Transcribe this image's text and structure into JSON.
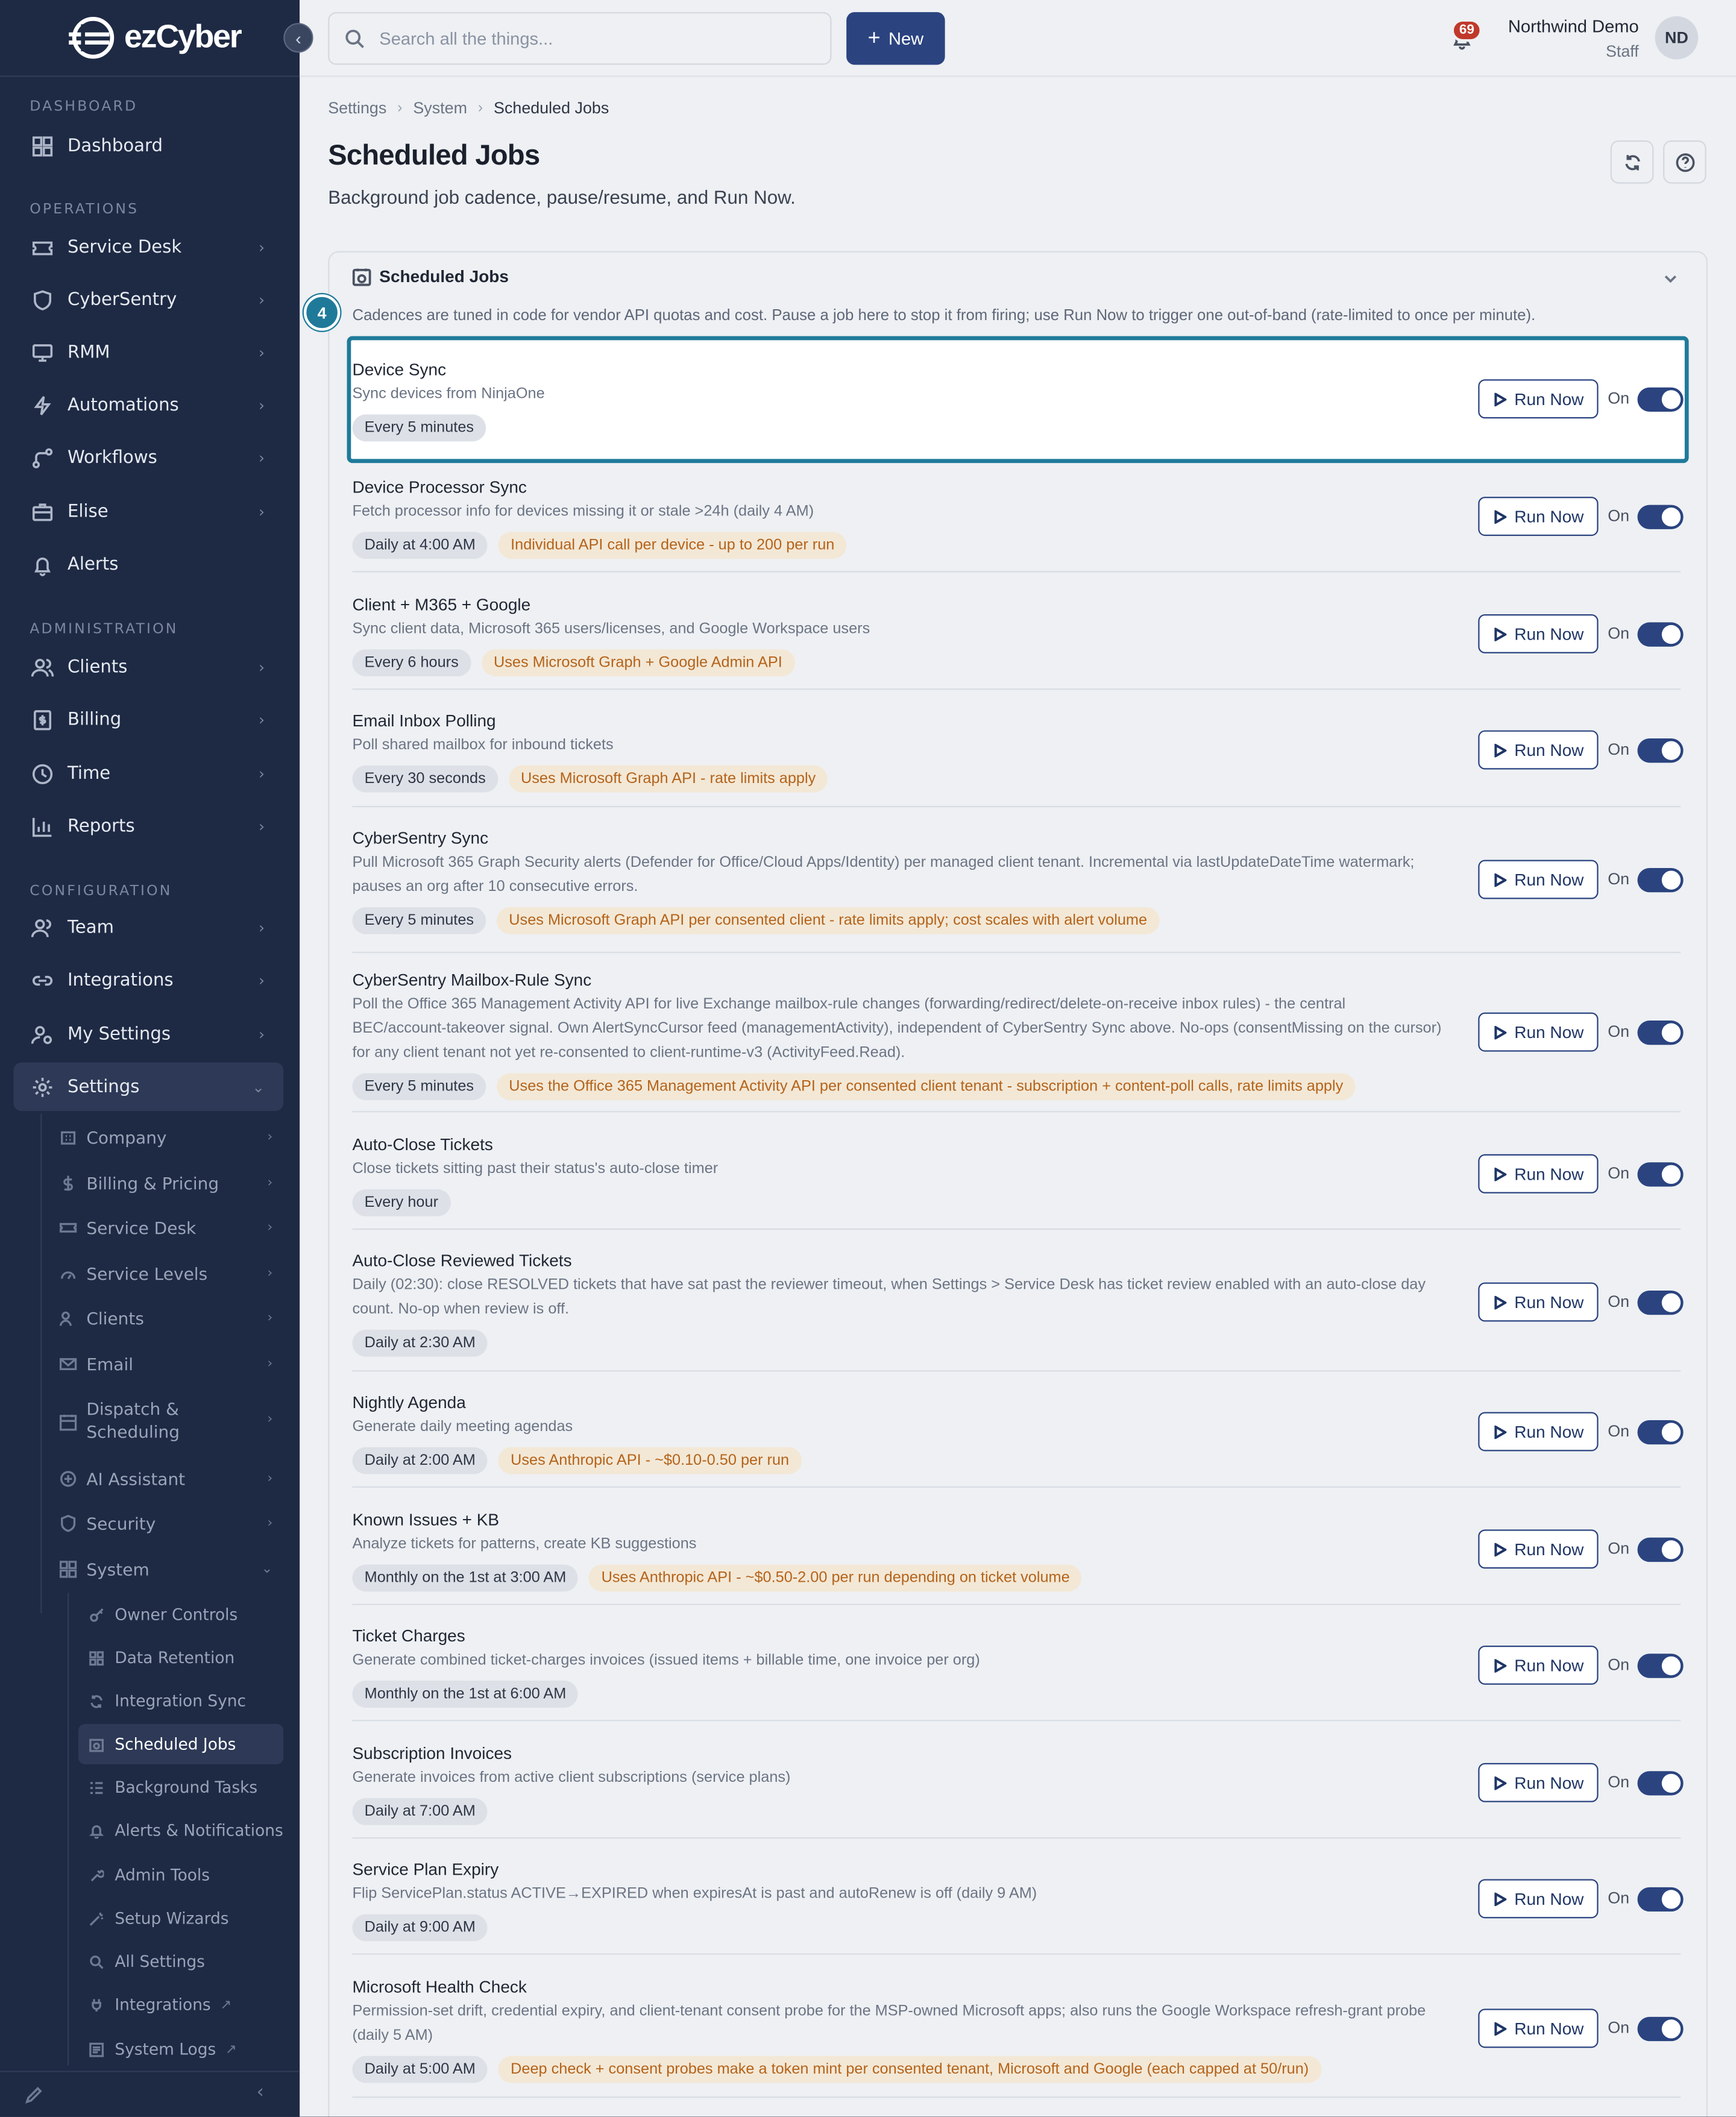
{
  "app": {
    "name": "ezCyber"
  },
  "sidebar": {
    "sections": {
      "dashboard": "DASHBOARD",
      "operations": "OPERATIONS",
      "administration": "ADMINISTRATION",
      "configuration": "CONFIGURATION"
    },
    "items": {
      "dashboard": "Dashboard",
      "service_desk": "Service Desk",
      "cybersentry": "CyberSentry",
      "rmm": "RMM",
      "automations": "Automations",
      "workflows": "Workflows",
      "elise": "Elise",
      "alerts": "Alerts",
      "clients": "Clients",
      "billing": "Billing",
      "time": "Time",
      "reports": "Reports",
      "team": "Team",
      "integrations": "Integrations",
      "my_settings": "My Settings",
      "settings": "Settings"
    },
    "settings_sub": {
      "company": "Company",
      "billing_pricing": "Billing & Pricing",
      "service_desk": "Service Desk",
      "service_levels": "Service Levels",
      "clients": "Clients",
      "email": "Email",
      "dispatch_1": "Dispatch &",
      "dispatch_2": "Scheduling",
      "ai_assistant": "AI Assistant",
      "security": "Security",
      "system": "System"
    },
    "system_sub": {
      "owner_controls": "Owner Controls",
      "data_retention": "Data Retention",
      "integration_sync": "Integration Sync",
      "scheduled_jobs": "Scheduled Jobs",
      "background_tasks": "Background Tasks",
      "alerts_notifications": "Alerts & Notifications",
      "admin_tools": "Admin Tools",
      "setup_wizards": "Setup Wizards",
      "all_settings": "All Settings",
      "integrations": "Integrations",
      "system_logs": "System Logs"
    }
  },
  "topbar": {
    "search_placeholder": "Search all the things...",
    "new_label": "New",
    "notification_count": "69",
    "user_name": "Northwind Demo",
    "user_role": "Staff",
    "user_initials": "ND"
  },
  "breadcrumb": {
    "c1": "Settings",
    "c2": "System",
    "c3": "Scheduled Jobs"
  },
  "page": {
    "title": "Scheduled Jobs",
    "subtitle": "Background job cadence, pause/resume, and Run Now."
  },
  "card": {
    "title": "Scheduled Jobs",
    "description": "Cadences are tuned in code for vendor API quotas and cost. Pause a job here to stop it from firing; use Run Now to trigger one out-of-band (rate-limited to once per minute).",
    "step": "4"
  },
  "labels": {
    "run_now": "Run Now",
    "on": "On"
  },
  "jobs": [
    {
      "name": "Device Sync",
      "desc": "Sync devices from NinjaOne",
      "cadence": "Every 5 minutes",
      "note": "",
      "enabled": true
    },
    {
      "name": "Device Processor Sync",
      "desc": "Fetch processor info for devices missing it or stale >24h (daily 4 AM)",
      "cadence": "Daily at 4:00 AM",
      "note": "Individual API call per device - up to 200 per run",
      "enabled": true
    },
    {
      "name": "Client + M365 + Google",
      "desc": "Sync client data, Microsoft 365 users/licenses, and Google Workspace users",
      "cadence": "Every 6 hours",
      "note": "Uses Microsoft Graph + Google Admin API",
      "enabled": true
    },
    {
      "name": "Email Inbox Polling",
      "desc": "Poll shared mailbox for inbound tickets",
      "cadence": "Every 30 seconds",
      "note": "Uses Microsoft Graph API - rate limits apply",
      "enabled": true
    },
    {
      "name": "CyberSentry Sync",
      "desc": "Pull Microsoft 365 Graph Security alerts (Defender for Office/Cloud Apps/Identity) per managed client tenant. Incremental via lastUpdateDateTime watermark; pauses an org after 10 consecutive errors.",
      "cadence": "Every 5 minutes",
      "note": "Uses Microsoft Graph API per consented client - rate limits apply; cost scales with alert volume",
      "enabled": true
    },
    {
      "name": "CyberSentry Mailbox-Rule Sync",
      "desc": "Poll the Office 365 Management Activity API for live Exchange mailbox-rule changes (forwarding/redirect/delete-on-receive inbox rules) - the central BEC/account-takeover signal. Own AlertSyncCursor feed (managementActivity), independent of CyberSentry Sync above. No-ops (consentMissing on the cursor) for any client tenant not yet re-consented to client-runtime-v3 (ActivityFeed.Read).",
      "cadence": "Every 5 minutes",
      "note": "Uses the Office 365 Management Activity API per consented client tenant - subscription + content-poll calls, rate limits apply",
      "enabled": true
    },
    {
      "name": "Auto-Close Tickets",
      "desc": "Close tickets sitting past their status's auto-close timer",
      "cadence": "Every hour",
      "note": "",
      "enabled": true
    },
    {
      "name": "Auto-Close Reviewed Tickets",
      "desc": "Daily (02:30): close RESOLVED tickets that have sat past the reviewer timeout, when Settings > Service Desk has ticket review enabled with an auto-close day count. No-op when review is off.",
      "cadence": "Daily at 2:30 AM",
      "note": "",
      "enabled": true
    },
    {
      "name": "Nightly Agenda",
      "desc": "Generate daily meeting agendas",
      "cadence": "Daily at 2:00 AM",
      "note": "Uses Anthropic API - ~$0.10-0.50 per run",
      "enabled": true
    },
    {
      "name": "Known Issues + KB",
      "desc": "Analyze tickets for patterns, create KB suggestions",
      "cadence": "Monthly on the 1st at 3:00 AM",
      "note": "Uses Anthropic API - ~$0.50-2.00 per run depending on ticket volume",
      "enabled": true
    },
    {
      "name": "Ticket Charges",
      "desc": "Generate combined ticket-charges invoices (issued items + billable time, one invoice per org)",
      "cadence": "Monthly on the 1st at 6:00 AM",
      "note": "",
      "enabled": true
    },
    {
      "name": "Subscription Invoices",
      "desc": "Generate invoices from active client subscriptions (service plans)",
      "cadence": "Daily at 7:00 AM",
      "note": "",
      "enabled": true
    },
    {
      "name": "Service Plan Expiry",
      "desc": "Flip ServicePlan.status ACTIVE→EXPIRED when expiresAt is past and autoRenew is off (daily 9 AM)",
      "cadence": "Daily at 9:00 AM",
      "note": "",
      "enabled": true
    },
    {
      "name": "Microsoft Health Check",
      "desc": "Permission-set drift, credential expiry, and client-tenant consent probe for the MSP-owned Microsoft apps; also runs the Google Workspace refresh-grant probe (daily 5 AM)",
      "cadence": "Daily at 5:00 AM",
      "note": "Deep check + consent probes make a token mint per consented tenant, Microsoft and Google (each capped at 50/run)",
      "enabled": true
    }
  ],
  "colors": {
    "sidebar_bg": "#1e2a44",
    "accent": "#2b4480",
    "highlight": "#1f7a9a",
    "warn_bg": "#f3e8d6",
    "warn_text": "#b5631a"
  }
}
